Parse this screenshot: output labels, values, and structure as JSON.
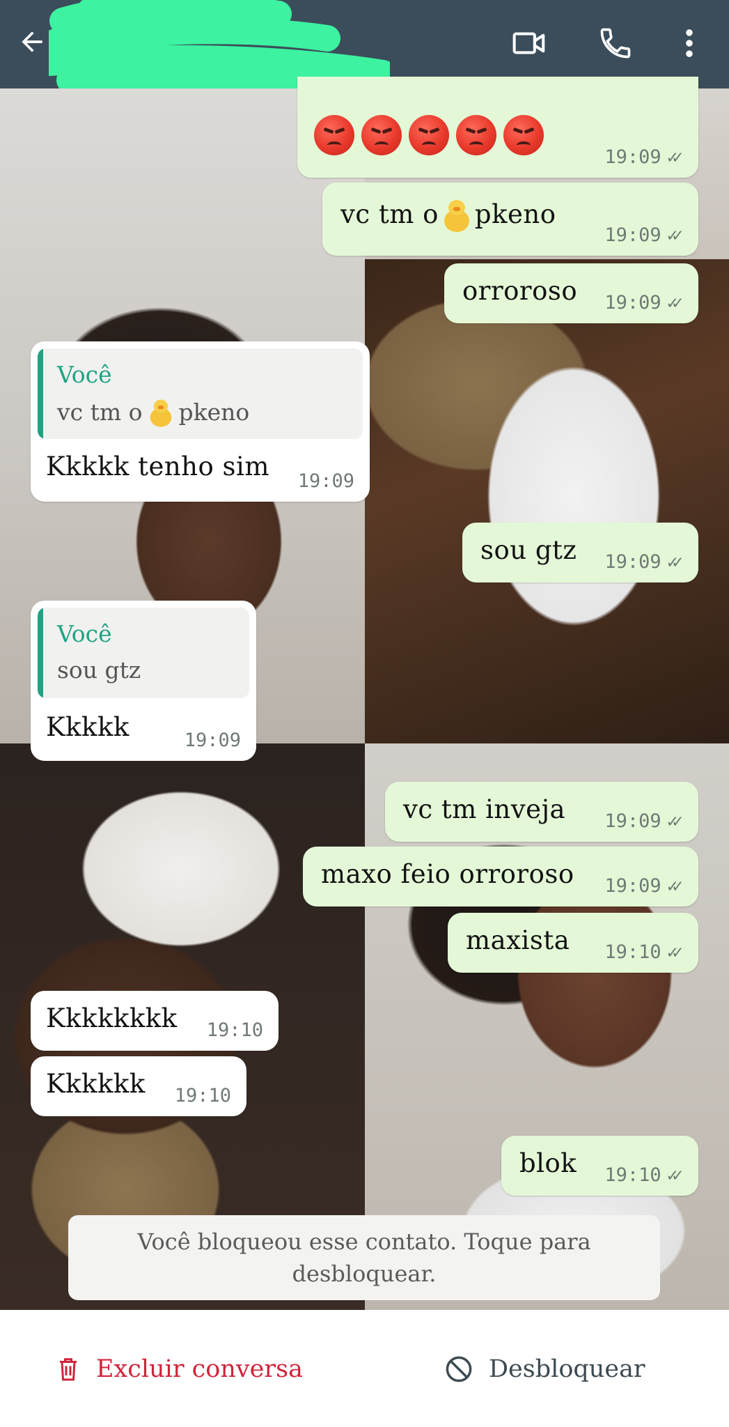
{
  "header": {
    "back_icon": "arrow-left-icon",
    "video_icon": "video-call-icon",
    "call_icon": "phone-icon",
    "menu_icon": "more-vertical-icon",
    "redaction_color": "#3df2a0",
    "bar_color": "#3b4d5a"
  },
  "messages": [
    {
      "text": "😡😡😡😡😡",
      "time": "19:09",
      "ticks": "✓✓"
    },
    {
      "text_before": "vc tm o",
      "text_after": "pkeno",
      "time": "19:09",
      "ticks": "✓✓"
    },
    {
      "text": "orroroso",
      "time": "19:09",
      "ticks": "✓✓"
    },
    {
      "quote_author": "Você",
      "quote_before": "vc tm o",
      "quote_after": "pkeno",
      "text": "Kkkkk tenho sim",
      "time": "19:09"
    },
    {
      "text": "sou gtz",
      "time": "19:09",
      "ticks": "✓✓"
    },
    {
      "quote_author": "Você",
      "quote_text": "sou gtz",
      "text": "Kkkkk",
      "time": "19:09"
    },
    {
      "text": "vc tm inveja",
      "time": "19:09",
      "ticks": "✓✓"
    },
    {
      "text": "maxo feio orroroso",
      "time": "19:09",
      "ticks": "✓✓"
    },
    {
      "text": "maxista",
      "time": "19:10",
      "ticks": "✓✓"
    },
    {
      "text": "Kkkkkkkk",
      "time": "19:10"
    },
    {
      "text": "Kkkkkk",
      "time": "19:10"
    },
    {
      "text": "blok",
      "time": "19:10",
      "ticks": "✓✓"
    }
  ],
  "system_notice": "Você bloqueou esse contato. Toque para desbloquear.",
  "bottom": {
    "delete_label": "Excluir conversa",
    "delete_icon": "trash-icon",
    "unblock_label": "Desbloquear",
    "unblock_icon": "block-icon",
    "delete_color": "#d0243b"
  },
  "colors": {
    "outgoing_bubble": "#e4f8d7",
    "incoming_bubble": "#ffffff",
    "quote_accent": "#1fa383"
  }
}
